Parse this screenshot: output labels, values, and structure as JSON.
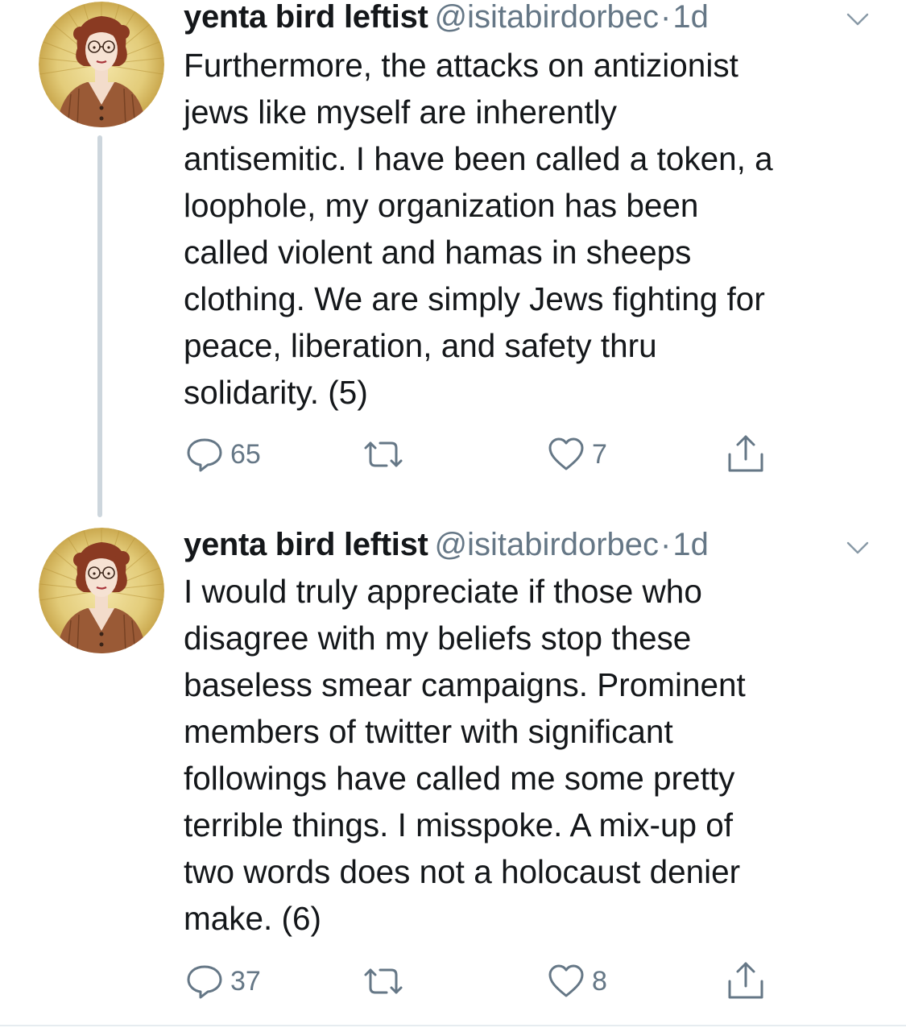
{
  "colors": {
    "text_primary": "#14171a",
    "text_secondary": "#657786",
    "thread_line": "#cdd6dd",
    "avatar_background": "#e3cc7a",
    "avatar_cardigan": "#9a5a36"
  },
  "icons": {
    "reply": "speech-bubble",
    "retweet": "retweet-arrows",
    "like": "heart-outline",
    "share": "share-upload",
    "menu": "chevron-down"
  },
  "tweets": [
    {
      "display_name": "yenta bird leftist",
      "handle": "@isitabirdorbec",
      "separator": "·",
      "time": "1d",
      "text": "Furthermore, the attacks on antizionist\njews like myself are inherently\nantisemitic. I have been called a token, a\nloophole, my organization has been\ncalled violent and hamas in sheeps\nclothing. We are simply Jews fighting for\npeace, liberation, and safety thru\nsolidarity. (5)",
      "replies": "65",
      "retweets": "",
      "likes": "7"
    },
    {
      "display_name": "yenta bird leftist",
      "handle": "@isitabirdorbec",
      "separator": "·",
      "time": "1d",
      "text": "I would truly appreciate if those who\ndisagree with my beliefs stop these\nbaseless smear campaigns. Prominent\nmembers of twitter with significant\nfollowings have called me some pretty\nterrible things. I misspoke. A mix-up of\ntwo words does not a holocaust denier\nmake. (6)",
      "replies": "37",
      "retweets": "",
      "likes": "8"
    }
  ]
}
